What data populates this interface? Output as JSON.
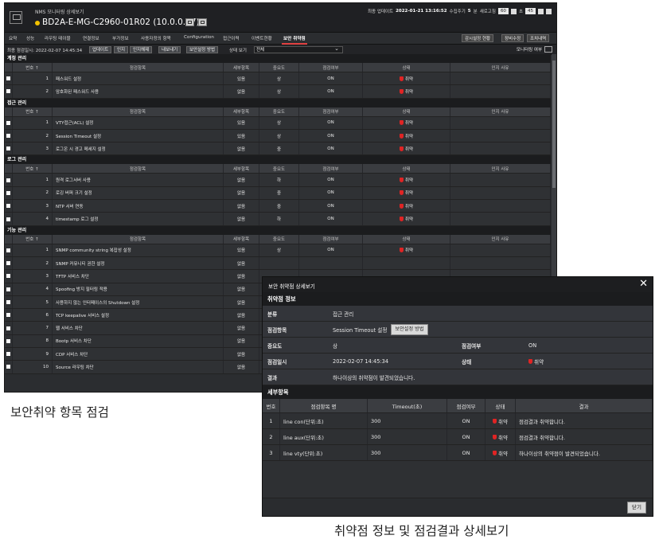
{
  "header": {
    "subtitle": "NMS 모니터링 상세보기",
    "device": "BD2A-E-MG-C2960-01R02 (10.0.0.87)",
    "last_update_label": "최종 업데이트",
    "last_update": "2022-01-21 13:16:52",
    "collect_label": "수집주기",
    "collect_value": "5",
    "collect_unit": "분",
    "refresh_label": "새로고침",
    "refresh_value": "60",
    "refresh_unit": "초",
    "refresh_value2": "45"
  },
  "tabs": [
    "요약",
    "성능",
    "라우팅 테이블",
    "연결정보",
    "부가정보",
    "사용자정의 항목",
    "Configuration",
    "접근이력",
    "이벤트현황",
    "보안 취약점"
  ],
  "right_buttons": [
    "감시설정 현황",
    "장비수정",
    "조치내역"
  ],
  "toolbar": {
    "last_check": "최종 점검일시: 2022-02-07 14:45:34",
    "buttons": [
      "업데이트",
      "인지",
      "인지해제",
      "내보내기",
      "보안설정 방법"
    ],
    "state_label": "상태 보기",
    "state_value": "전체",
    "monitor_label": "모니터링 여부"
  },
  "grid_headers": [
    "번호 ↑",
    "점검항목",
    "세부항목",
    "중요도",
    "점검여부",
    "상태",
    "인지 사유"
  ],
  "sections": [
    {
      "name": "계정 관리",
      "rows": [
        {
          "no": "1",
          "item": "패스워드 설정",
          "detail": "있음",
          "sev": "상",
          "check": "ON",
          "status": "취약"
        },
        {
          "no": "2",
          "item": "암호화된 패스워드 사용",
          "detail": "없음",
          "sev": "상",
          "check": "ON",
          "status": "취약"
        }
      ]
    },
    {
      "name": "접근 관리",
      "rows": [
        {
          "no": "1",
          "item": "VTY접근(ACL) 설정",
          "detail": "있음",
          "sev": "상",
          "check": "ON",
          "status": "취약"
        },
        {
          "no": "2",
          "item": "Session Timeout 설정",
          "detail": "있음",
          "sev": "상",
          "check": "ON",
          "status": "취약"
        },
        {
          "no": "3",
          "item": "로그온 시 경고 메세지 설정",
          "detail": "없음",
          "sev": "중",
          "check": "ON",
          "status": "취약"
        }
      ]
    },
    {
      "name": "로그 관리",
      "rows": [
        {
          "no": "1",
          "item": "원격 로그서버 사용",
          "detail": "없음",
          "sev": "하",
          "check": "ON",
          "status": "취약"
        },
        {
          "no": "2",
          "item": "로깅 버퍼 크기 설정",
          "detail": "없음",
          "sev": "중",
          "check": "ON",
          "status": "취약"
        },
        {
          "no": "3",
          "item": "NTP 서버 연동",
          "detail": "없음",
          "sev": "중",
          "check": "ON",
          "status": "취약"
        },
        {
          "no": "4",
          "item": "timestamp 로그 설정",
          "detail": "없음",
          "sev": "하",
          "check": "ON",
          "status": "취약"
        }
      ]
    },
    {
      "name": "기능 관리",
      "rows": [
        {
          "no": "1",
          "item": "SNMP community string 복잡성 설정",
          "detail": "있음",
          "sev": "상",
          "check": "ON",
          "status": "취약"
        },
        {
          "no": "2",
          "item": "SNMP 커뮤니티 권한 설정",
          "detail": "없음",
          "sev": "",
          "check": "",
          "status": ""
        },
        {
          "no": "3",
          "item": "TFTP 서비스 차단",
          "detail": "없음",
          "sev": "",
          "check": "",
          "status": ""
        },
        {
          "no": "4",
          "item": "Spoofing 방지 필터링 적용",
          "detail": "없음",
          "sev": "",
          "check": "",
          "status": ""
        },
        {
          "no": "5",
          "item": "사용하지 않는 인터페이스의 Shutdown 설정",
          "detail": "없음",
          "sev": "",
          "check": "",
          "status": ""
        },
        {
          "no": "6",
          "item": "TCP keepalive 서비스 설정",
          "detail": "없음",
          "sev": "",
          "check": "",
          "status": ""
        },
        {
          "no": "7",
          "item": "웹 서비스 차단",
          "detail": "없음",
          "sev": "",
          "check": "",
          "status": ""
        },
        {
          "no": "8",
          "item": "Bootp 서비스 차단",
          "detail": "없음",
          "sev": "",
          "check": "",
          "status": ""
        },
        {
          "no": "9",
          "item": "CDP 서비스 차단",
          "detail": "없음",
          "sev": "",
          "check": "",
          "status": ""
        },
        {
          "no": "10",
          "item": "Source 라우팅 차단",
          "detail": "없음",
          "sev": "",
          "check": "",
          "status": ""
        }
      ]
    }
  ],
  "captions": {
    "left": "보안취약 항목 점검",
    "right": "취약점 정보 및 점검결과 상세보기"
  },
  "modal": {
    "title": "보안 취약점 상세보기",
    "info_title": "취약점 정보",
    "category_label": "분류",
    "category": "접근 관리",
    "item_label": "점검항목",
    "item": "Session Timeout 설정",
    "item_btn": "보안설정 방법",
    "sev_label": "중요도",
    "sev": "상",
    "check_label": "점검여부",
    "check": "ON",
    "date_label": "점검일시",
    "date": "2022-02-07 14:45:34",
    "status_label": "상태",
    "status": "취약",
    "result_label": "결과",
    "result": "하나이상의 취약점이 발견되었습니다.",
    "detail_title": "세부항목",
    "detail_headers": [
      "번호",
      "점검항목 명",
      "Timeout(초)",
      "점검여부",
      "상태",
      "결과"
    ],
    "details": [
      {
        "no": "1",
        "name": "line con(단위:초)",
        "timeout": "300",
        "check": "ON",
        "status": "취약",
        "result": "점검결과 취약합니다."
      },
      {
        "no": "2",
        "name": "line aux(단위:초)",
        "timeout": "300",
        "check": "ON",
        "status": "취약",
        "result": "점검결과 취약합니다."
      },
      {
        "no": "3",
        "name": "line vty(단위:초)",
        "timeout": "300",
        "check": "ON",
        "status": "취약",
        "result": "하나이상의 취약점이 발견되었습니다."
      }
    ],
    "close_label": "닫기"
  }
}
